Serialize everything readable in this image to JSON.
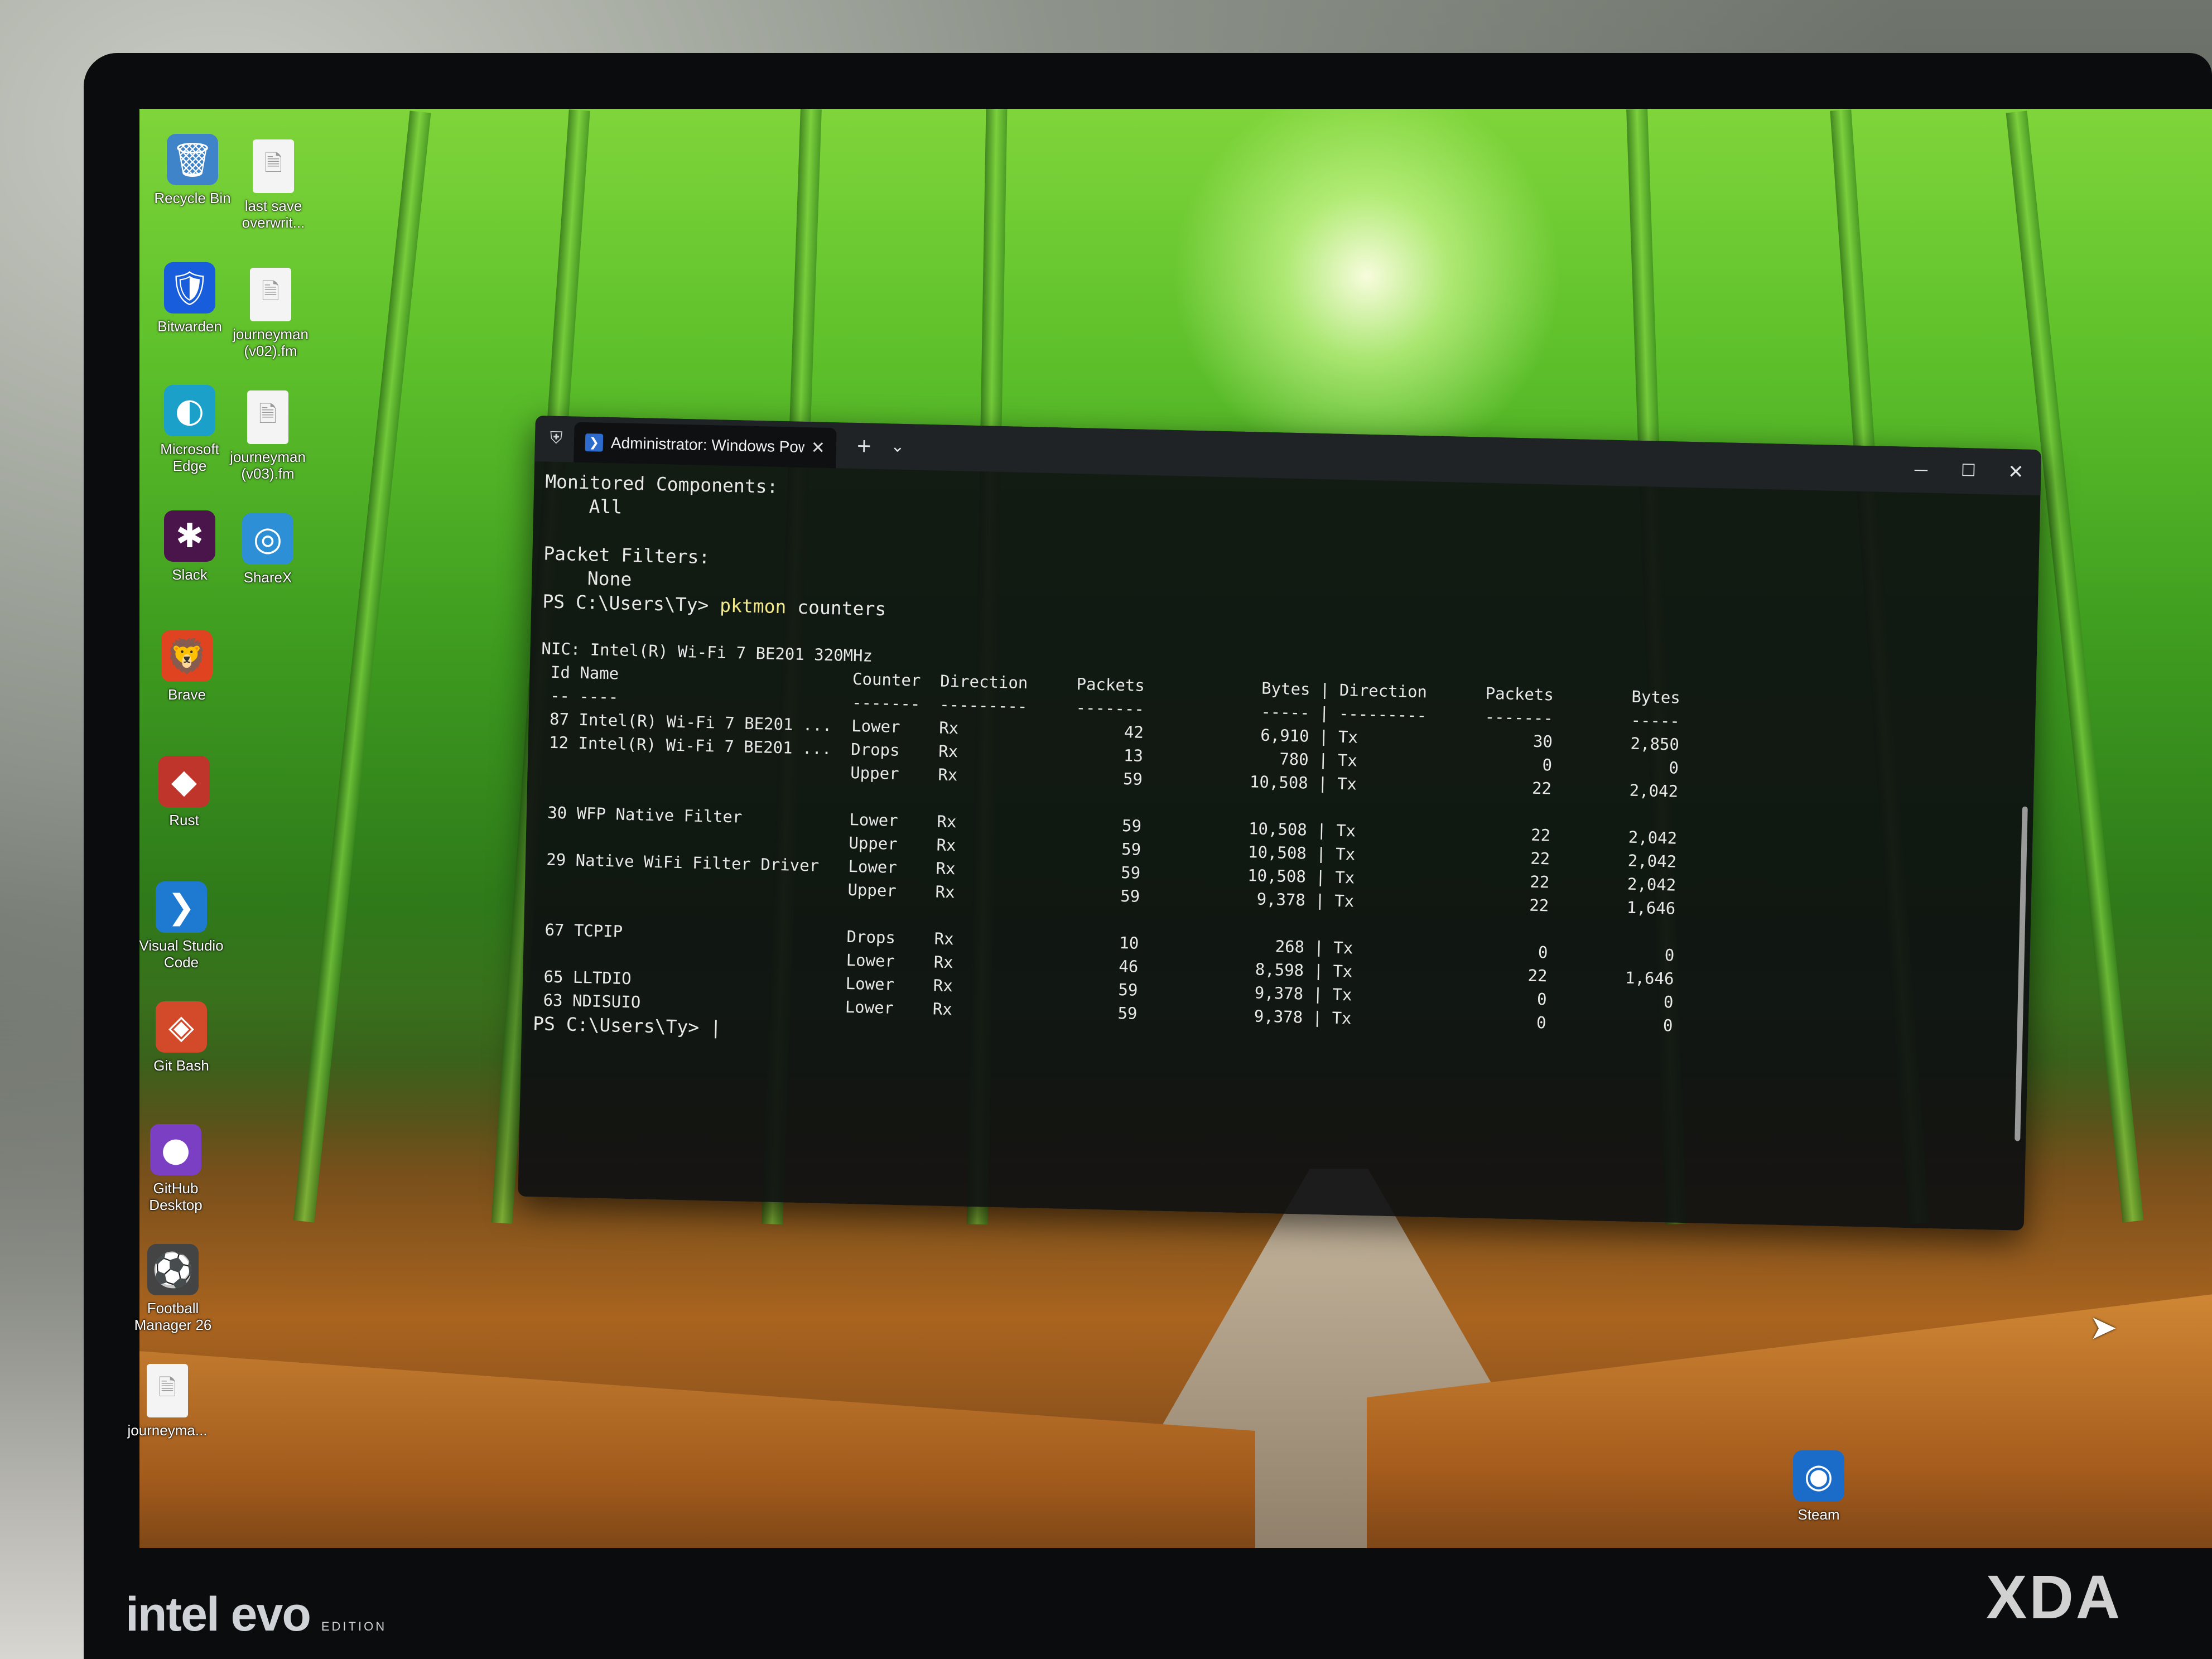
{
  "desktop": {
    "icons": [
      {
        "label": "Recycle Bin",
        "glyph": "🗑",
        "bg": "#3f84c9"
      },
      {
        "label": "last save\noverwrit...",
        "glyph": "🗎",
        "doc": true
      },
      {
        "label": "Bitwarden",
        "glyph": "🛡",
        "bg": "#175ddc"
      },
      {
        "label": "journeyman\n(v02).fm",
        "glyph": "🗎",
        "doc": true
      },
      {
        "label": "Microsoft\nEdge",
        "glyph": "◐",
        "bg": "#1aa0c9"
      },
      {
        "label": "journeyman\n(v03).fm",
        "glyph": "🗎",
        "doc": true
      },
      {
        "label": "Slack",
        "glyph": "✱",
        "bg": "#4a154b"
      },
      {
        "label": "ShareX",
        "glyph": "◎",
        "bg": "#2d8fd6"
      },
      {
        "label": "Brave",
        "glyph": "🦁",
        "bg": "#e0431f"
      },
      {
        "label": "Rust",
        "glyph": "◆",
        "bg": "#c0352b"
      },
      {
        "label": "Visual Studio\nCode",
        "glyph": "❯",
        "bg": "#1e7ad1"
      },
      {
        "label": "Git Bash",
        "glyph": "◈",
        "bg": "#d34a2a"
      },
      {
        "label": "GitHub\nDesktop",
        "glyph": "●",
        "bg": "#7b3fc4"
      },
      {
        "label": "Football\nManager 26",
        "glyph": "⚽",
        "bg": "#444444"
      },
      {
        "label": "journeyma...",
        "glyph": "🗎",
        "doc": true
      },
      {
        "label": "Steam",
        "glyph": "◉",
        "bg": "#1b6cc9"
      }
    ]
  },
  "terminal": {
    "tab_title": "Administrator: Windows Pow",
    "new_tab": "+",
    "dropdown": "⌄",
    "minimize": "—",
    "maximize": "☐",
    "close": "✕",
    "lines_before_cmd": "Monitored Components:\n    All\n\nPacket Filters:\n    None",
    "prompt": "PS C:\\Users\\Ty> ",
    "command": "pktmon",
    "command_args": " counters",
    "output": "\nNIC: Intel(R) Wi-Fi 7 BE201 320MHz\n Id Name                        Counter  Direction     Packets            Bytes | Direction      Packets        Bytes\n -- ----                        -------  ---------     -------            ----- | ---------      -------        -----\n 87 Intel(R) Wi-Fi 7 BE201 ...  Lower    Rx                 42            6,910 | Tx                  30        2,850\n 12 Intel(R) Wi-Fi 7 BE201 ...  Drops    Rx                 13              780 | Tx                   0            0\n                                Upper    Rx                 59           10,508 | Tx                  22        2,042\n\n 30 WFP Native Filter           Lower    Rx                 59           10,508 | Tx                  22        2,042\n                                Upper    Rx                 59           10,508 | Tx                  22        2,042\n 29 Native WiFi Filter Driver   Lower    Rx                 59           10,508 | Tx                  22        2,042\n                                Upper    Rx                 59            9,378 | Tx                  22        1,646\n\n 67 TCPIP                       Drops    Rx                 10              268 | Tx                   0            0\n                                Lower    Rx                 46            8,598 | Tx                  22        1,646\n 65 LLTDIO                      Lower    Rx                 59            9,378 | Tx                   0            0\n 63 NDISUIO                     Lower    Rx                 59            9,378 | Tx                   0            0\n",
    "final_prompt": "PS C:\\Users\\Ty> |"
  },
  "branding": {
    "laptop_logo": "intel evo",
    "laptop_edition": "EDITION",
    "watermark": "XDA"
  }
}
